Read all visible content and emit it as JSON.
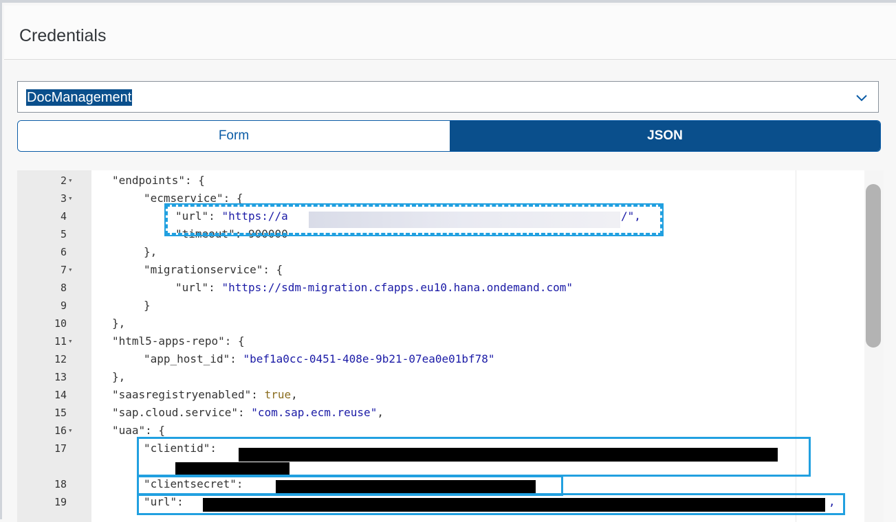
{
  "window": {
    "title": "Credentials"
  },
  "instance_select": {
    "value": "DocManagement",
    "icon": "chevron-down-icon"
  },
  "view_toggle": {
    "form_label": "Form",
    "json_label": "JSON",
    "selected": "JSON"
  },
  "editor": {
    "lines": [
      {
        "n": "2",
        "fold": true,
        "indent": 1,
        "parts": [
          [
            "k",
            "\"endpoints\": {"
          ]
        ]
      },
      {
        "n": "3",
        "fold": true,
        "indent": 2,
        "parts": [
          [
            "k",
            "\"ecmservice\": {"
          ]
        ]
      },
      {
        "n": "4",
        "fold": false,
        "indent": 3,
        "parts": [
          [
            "k",
            "\"url\": "
          ],
          [
            "s",
            "\"https://a"
          ]
        ],
        "tail": "/\","
      },
      {
        "n": "5",
        "fold": false,
        "indent": 3,
        "parts": [
          [
            "k",
            "\"timeout\": 900000"
          ]
        ]
      },
      {
        "n": "6",
        "fold": false,
        "indent": 2,
        "parts": [
          [
            "k",
            "},"
          ]
        ]
      },
      {
        "n": "7",
        "fold": true,
        "indent": 2,
        "parts": [
          [
            "k",
            "\"migrationservice\": {"
          ]
        ]
      },
      {
        "n": "8",
        "fold": false,
        "indent": 3,
        "parts": [
          [
            "k",
            "\"url\": "
          ],
          [
            "s",
            "\"https://sdm-migration.cfapps.eu10.hana.ondemand.com\""
          ]
        ]
      },
      {
        "n": "9",
        "fold": false,
        "indent": 2,
        "parts": [
          [
            "k",
            "}"
          ]
        ]
      },
      {
        "n": "10",
        "fold": false,
        "indent": 1,
        "parts": [
          [
            "k",
            "},"
          ]
        ]
      },
      {
        "n": "11",
        "fold": true,
        "indent": 1,
        "parts": [
          [
            "k",
            "\"html5-apps-repo\": {"
          ]
        ]
      },
      {
        "n": "12",
        "fold": false,
        "indent": 2,
        "parts": [
          [
            "k",
            "\"app_host_id\": "
          ],
          [
            "s",
            "\"bef1a0cc-0451-408e-9b21-07ea0e01bf78\""
          ]
        ]
      },
      {
        "n": "13",
        "fold": false,
        "indent": 1,
        "parts": [
          [
            "k",
            "},"
          ]
        ]
      },
      {
        "n": "14",
        "fold": false,
        "indent": 1,
        "parts": [
          [
            "k",
            "\"saasregistryenabled\": "
          ],
          [
            "b",
            "true"
          ],
          [
            "k",
            ","
          ]
        ]
      },
      {
        "n": "15",
        "fold": false,
        "indent": 1,
        "parts": [
          [
            "k",
            "\"sap.cloud.service\": "
          ],
          [
            "s",
            "\"com.sap.ecm.reuse\""
          ],
          [
            "k",
            ","
          ]
        ]
      },
      {
        "n": "16",
        "fold": true,
        "indent": 1,
        "parts": [
          [
            "k",
            "\"uaa\": {"
          ]
        ]
      },
      {
        "n": "17",
        "fold": false,
        "indent": 2,
        "parts": [
          [
            "k",
            "\"clientid\": "
          ]
        ]
      },
      {
        "n": "",
        "fold": false,
        "indent": 2,
        "parts": []
      },
      {
        "n": "18",
        "fold": false,
        "indent": 2,
        "parts": [
          [
            "k",
            "\"clientsecret\": "
          ]
        ]
      },
      {
        "n": "19",
        "fold": false,
        "indent": 2,
        "parts": [
          [
            "k",
            "\"url\": "
          ]
        ],
        "tail": ","
      }
    ]
  }
}
